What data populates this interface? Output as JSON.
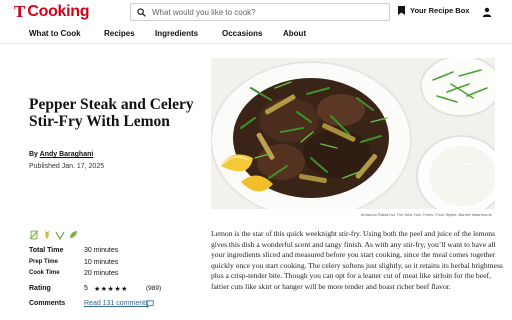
{
  "header": {
    "logo_letter": "T",
    "logo_word": "Cooking",
    "search_placeholder": "What would you like to cook?",
    "recipe_box_label": "Your Recipe Box"
  },
  "nav": {
    "items": [
      {
        "label": "What to Cook"
      },
      {
        "label": "Recipes"
      },
      {
        "label": "Ingredients"
      },
      {
        "label": "Occasions"
      },
      {
        "label": "About"
      }
    ]
  },
  "recipe": {
    "title": "Pepper Steak and Celery Stir-Fry With Lemon",
    "byline_prefix": "By ",
    "author": "Andy Baraghani",
    "published": "Published Jan. 17, 2025",
    "photo_credit": "Armando Rafael for The New York Times. Food Stylist: Barrett Washburne.",
    "body": "Lemon is the star of this quick weeknight stir-fry. Using both the peel and juice of the lemons gives this dish a wonderful scent and tangy finish. As with any stir-fry, you’ll want to have all your ingredients sliced and measured before you start cooking, since the meal comes together quickly once you start cooking. The celery softens just slightly, so it retains its herbal brightness plus a crisp-tender bite. Though you can opt for a leaner cut of meat like sirloin for the beef, fattier cuts like skirt or hanger will be more tender and boast richer beef flavor."
  },
  "meta": {
    "total_time_label": "Total Time",
    "total_time": "30 minutes",
    "prep_time_label": "Prep Time",
    "prep_time": "10 minutes",
    "cook_time_label": "Cook Time",
    "cook_time": "20 minutes",
    "rating_label": "Rating",
    "rating_value": "5",
    "rating_stars": "★★★★★",
    "rating_count": "(989)",
    "comments_label": "Comments",
    "comments_link": "Read 131 comments"
  },
  "colors": {
    "brand": "#d0021b",
    "link": "#326891"
  },
  "icons": [
    "search-icon",
    "bookmark-icon",
    "user-icon",
    "comment-icon",
    "dairy-free-icon",
    "gluten-free-icon",
    "low-carb-icon"
  ]
}
